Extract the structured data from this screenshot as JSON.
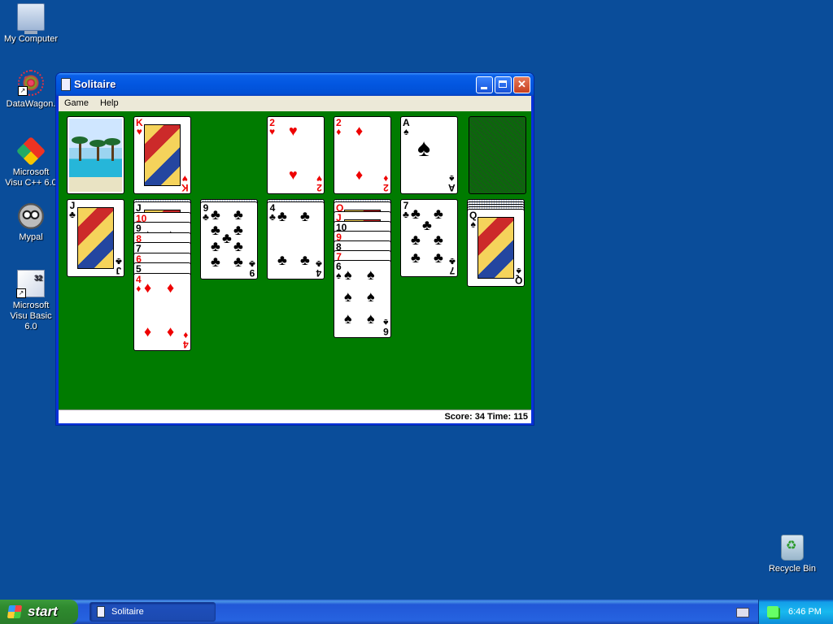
{
  "desktop": {
    "icons": [
      {
        "label": "My Computer"
      },
      {
        "label": "DataWagon."
      },
      {
        "label": "Microsoft Visu C++ 6.0"
      },
      {
        "label": "Mypal"
      },
      {
        "label": "Microsoft Visu Basic 6.0"
      },
      {
        "label": "Recycle Bin"
      }
    ]
  },
  "window": {
    "title": "Solitaire",
    "menu": [
      "Game",
      "Help"
    ],
    "status": "Score: 34 Time: 115"
  },
  "game": {
    "stock": {
      "face": "back",
      "picture": "beach-palm-trees"
    },
    "waste": {
      "rank": "K",
      "suit": "♥",
      "color": "red"
    },
    "foundations": [
      {
        "rank": "2",
        "suit": "♥",
        "color": "red"
      },
      {
        "rank": "2",
        "suit": "♦",
        "color": "red"
      },
      {
        "rank": "A",
        "suit": "♠",
        "color": "black"
      },
      {
        "rank": "",
        "suit": "",
        "color": "empty"
      }
    ],
    "tableau": [
      {
        "cards": [
          {
            "rank": "J",
            "suit": "♣",
            "color": "black"
          }
        ]
      },
      {
        "cards": [
          {
            "rank": "J",
            "suit": "♠",
            "color": "black"
          },
          {
            "rank": "10",
            "suit": "♥",
            "color": "red"
          },
          {
            "rank": "9",
            "suit": "♠",
            "color": "black"
          },
          {
            "rank": "8",
            "suit": "♥",
            "color": "red"
          },
          {
            "rank": "7",
            "suit": "♠",
            "color": "black"
          },
          {
            "rank": "6",
            "suit": "♥",
            "color": "red"
          },
          {
            "rank": "5",
            "suit": "♠",
            "color": "black"
          },
          {
            "rank": "4",
            "suit": "♦",
            "color": "red"
          }
        ]
      },
      {
        "cards": [
          {
            "rank": "9",
            "suit": "♣",
            "color": "black"
          }
        ]
      },
      {
        "cards": [
          {
            "rank": "4",
            "suit": "♣",
            "color": "black"
          }
        ]
      },
      {
        "cards": [
          {
            "rank": "Q",
            "suit": "♥",
            "color": "red"
          },
          {
            "rank": "J",
            "suit": "♠",
            "color": "red"
          },
          {
            "rank": "10",
            "suit": "♠",
            "color": "black"
          },
          {
            "rank": "9",
            "suit": "♥",
            "color": "red"
          },
          {
            "rank": "8",
            "suit": "♠",
            "color": "black"
          },
          {
            "rank": "7",
            "suit": "♥",
            "color": "red"
          },
          {
            "rank": "6",
            "suit": "♠",
            "color": "black"
          }
        ]
      },
      {
        "cards": [
          {
            "rank": "7",
            "suit": "♣",
            "color": "black"
          }
        ]
      },
      {
        "cards": [
          {
            "rank": "Q",
            "suit": "♠",
            "color": "black"
          }
        ]
      }
    ]
  },
  "taskbar": {
    "start_label": "start",
    "task_label": "Solitaire",
    "clock": "6:46 PM"
  }
}
